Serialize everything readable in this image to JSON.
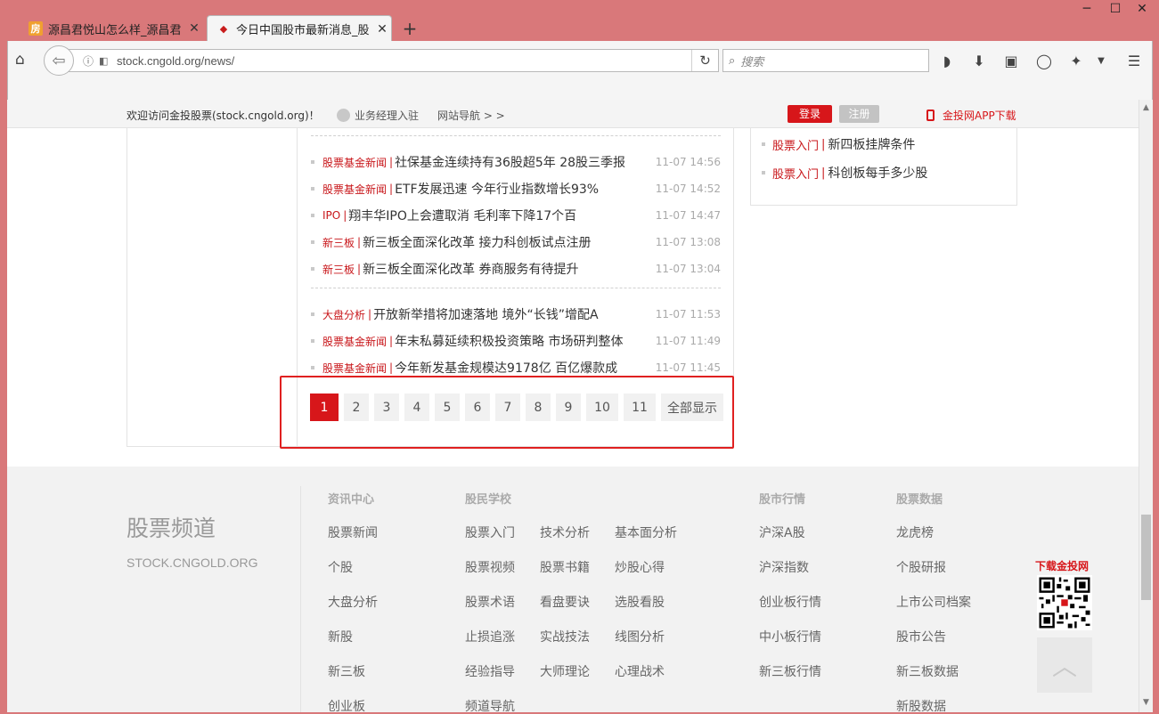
{
  "browser": {
    "tabs": [
      {
        "favicon": "fang-favicon",
        "title": "源昌君悦山怎么样_源昌君..."
      },
      {
        "favicon": "cngold-favicon",
        "title": "今日中国股市最新消息_股..."
      }
    ],
    "favicon_fang_glyph": "房",
    "url_host": "stock.cngold.org",
    "url_path": "/news/",
    "search_placeholder": "搜索"
  },
  "topbar": {
    "welcome": "欢迎访问金投股票(stock.cngold.org)！",
    "manager": "业务经理入驻",
    "site_nav": "网站导航 > >",
    "login": "登录",
    "register": "注册",
    "app_download": "金投网APP下载"
  },
  "right_news": [
    {
      "cat": "股票入门",
      "title": "新四板挂牌条件"
    },
    {
      "cat": "股票入门",
      "title": "科创板每手多少股"
    }
  ],
  "news_group1": [
    {
      "cat": "股票基金新闻",
      "title": "社保基金连续持有36股超5年 28股三季报",
      "time": "11-07 14:56"
    },
    {
      "cat": "股票基金新闻",
      "title": "ETF发展迅速 今年行业指数增长93%",
      "time": "11-07 14:52"
    },
    {
      "cat": "IPO",
      "title": "翔丰华IPO上会遭取消 毛利率下降17个百",
      "time": "11-07 14:47"
    },
    {
      "cat": "新三板",
      "title": "新三板全面深化改革 接力科创板试点注册",
      "time": "11-07 13:08"
    },
    {
      "cat": "新三板",
      "title": "新三板全面深化改革 券商服务有待提升",
      "time": "11-07 13:04"
    }
  ],
  "news_group2": [
    {
      "cat": "大盘分析",
      "title": "开放新举措将加速落地 境外“长钱”增配A",
      "time": "11-07 11:53"
    },
    {
      "cat": "股票基金新闻",
      "title": "年末私募延续积极投资策略 市场研判整体",
      "time": "11-07 11:49"
    },
    {
      "cat": "股票基金新闻",
      "title": "今年新发基金规模达9178亿 百亿爆款成",
      "time": "11-07 11:45"
    }
  ],
  "pagination": {
    "current": 1,
    "pages": [
      "1",
      "2",
      "3",
      "4",
      "5",
      "6",
      "7",
      "8",
      "9",
      "10",
      "11"
    ],
    "show_all": "全部显示"
  },
  "footer": {
    "brand": "股票频道",
    "brand_sub": "STOCK.CNGOLD.ORG",
    "columns": [
      {
        "heading": "资讯中心",
        "links": [
          "股票新闻",
          "个股",
          "大盘分析",
          "新股",
          "新三板",
          "创业板"
        ]
      },
      {
        "heading": "股民学校",
        "links": [
          "股票入门",
          "股票视频",
          "股票术语",
          "止损追涨",
          "经验指导",
          "频道导航"
        ]
      },
      {
        "heading": "",
        "links": [
          "技术分析",
          "股票书籍",
          "看盘要诀",
          "实战技法",
          "大师理论"
        ]
      },
      {
        "heading": "",
        "links": [
          "基本面分析",
          "炒股心得",
          "选股看股",
          "线图分析",
          "心理战术"
        ]
      },
      {
        "heading": "股市行情",
        "links": [
          "沪深A股",
          "沪深指数",
          "创业板行情",
          "中小板行情",
          "新三板行情"
        ]
      },
      {
        "heading": "股票数据",
        "links": [
          "龙虎榜",
          "个股研报",
          "上市公司档案",
          "股市公告",
          "新三板数据",
          "新股数据"
        ]
      }
    ],
    "qr_label": "下载金投网"
  },
  "colors": {
    "chrome": "#d9787a",
    "accent_red": "#d7161a",
    "footer_bg": "#f2f2f2"
  }
}
